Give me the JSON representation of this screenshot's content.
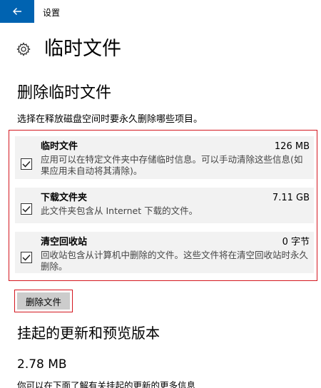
{
  "titlebar": {
    "back_icon": "arrow-left-icon",
    "title": "设置",
    "accent_color": "#0063b1"
  },
  "header": {
    "icon": "gear-icon",
    "title": "临时文件"
  },
  "section": {
    "title": "删除临时文件",
    "description": "选择在释放磁盘空间时要永久删除哪些项目。",
    "highlight_color": "#d4171f"
  },
  "items": [
    {
      "name": "临时文件",
      "size": "126 MB",
      "checked": true,
      "description": "应用可以在特定文件夹中存储临时信息。可以手动清除这些信息(如果应用未自动将其清除)。"
    },
    {
      "name": "下载文件夹",
      "size": "7.11 GB",
      "checked": true,
      "description": "此文件夹包含从 Internet 下载的文件。"
    },
    {
      "name": "清空回收站",
      "size": "0 字节",
      "checked": true,
      "description": "回收站包含从计算机中删除的文件。这些文件将在清空回收站时永久删除。"
    }
  ],
  "delete_button": {
    "label": "删除文件"
  },
  "pending": {
    "title": "挂起的更新和预览版本",
    "size": "2.78 MB",
    "description": "你可以在下面了解有关挂起的更新的更多信息"
  }
}
